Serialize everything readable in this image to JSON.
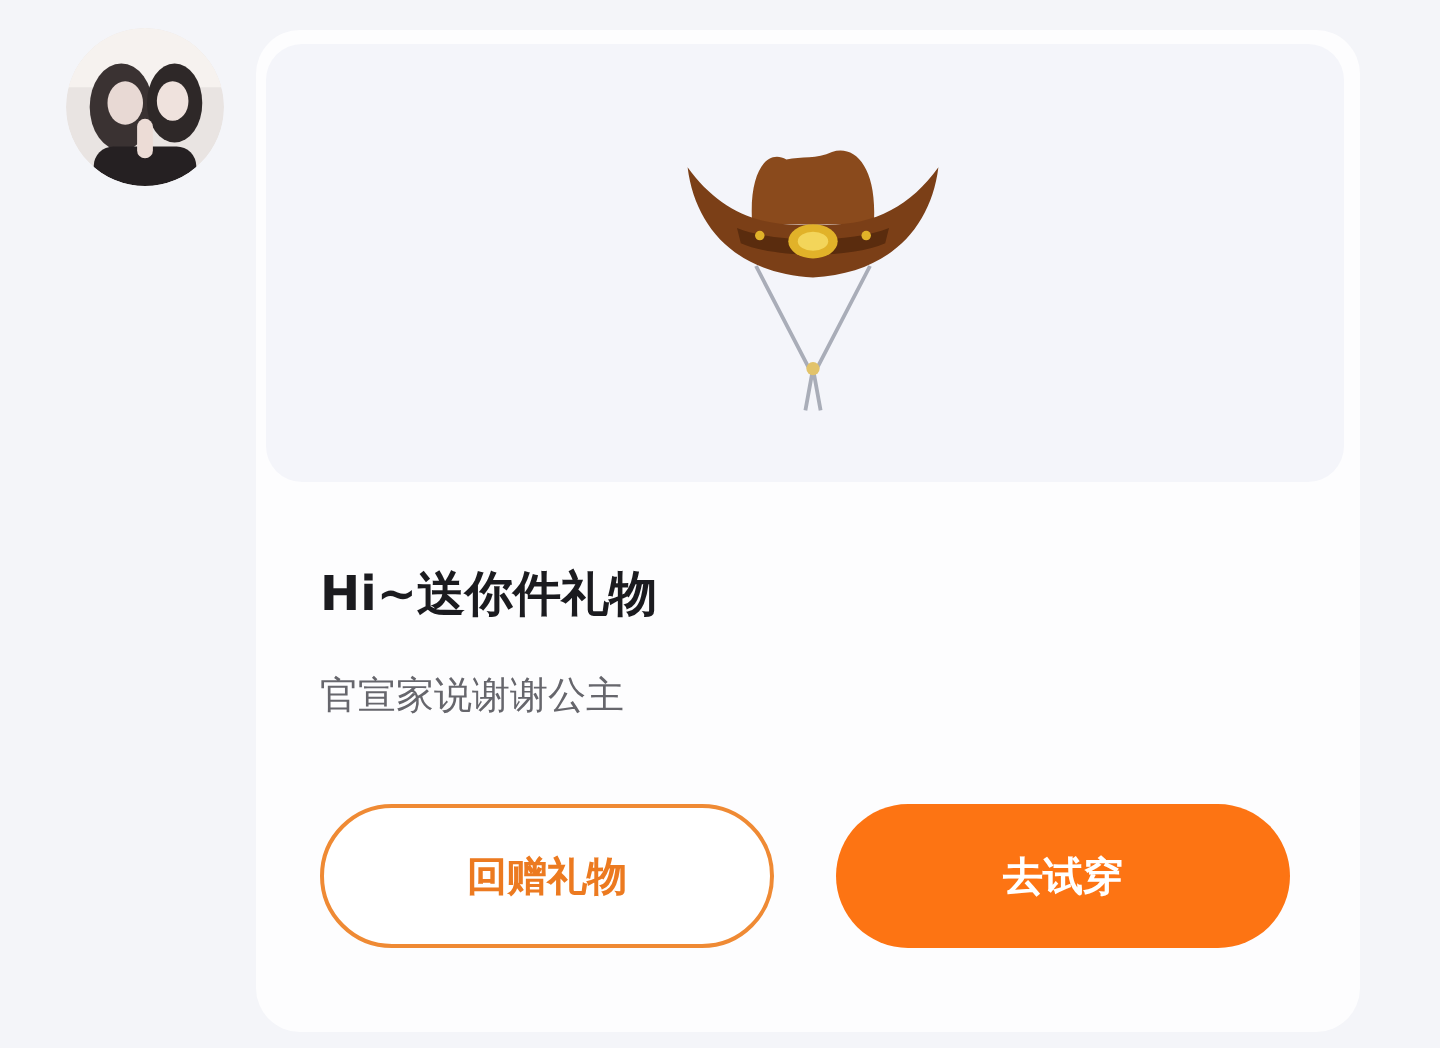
{
  "gift_card": {
    "title": "Hi~送你件礼物",
    "message": "官宣家说谢谢公主",
    "buttons": [
      {
        "label": "回赠礼物",
        "kind": "outline"
      },
      {
        "label": "去试穿",
        "kind": "filled"
      }
    ]
  }
}
